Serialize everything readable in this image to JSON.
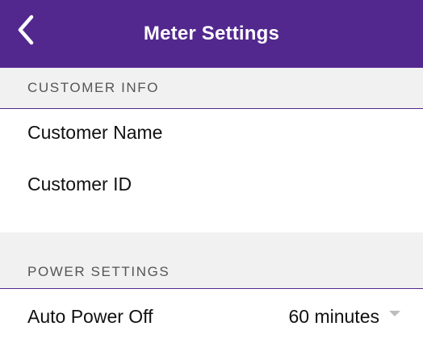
{
  "header": {
    "title": "Meter Settings",
    "back_icon": "chevron-left-icon"
  },
  "colors": {
    "header_bg": "#52288f",
    "section_bg": "#f1f1f1",
    "divider": "#52288f"
  },
  "sections": {
    "customer_info": {
      "title": "CUSTOMER INFO",
      "rows": {
        "customer_name": {
          "label": "Customer Name"
        },
        "customer_id": {
          "label": "Customer ID"
        }
      }
    },
    "power_settings": {
      "title": "POWER SETTINGS",
      "rows": {
        "auto_power_off": {
          "label": "Auto Power Off",
          "value": "60 minutes",
          "icon": "caret-down-icon"
        }
      }
    }
  }
}
